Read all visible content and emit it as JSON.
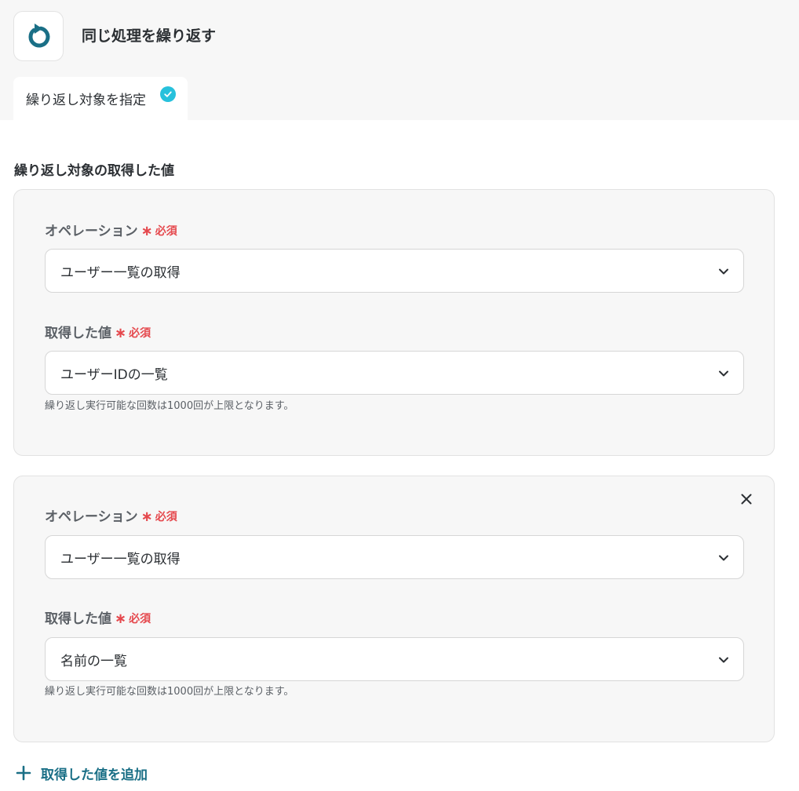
{
  "header": {
    "title": "同じ処理を繰り返す",
    "icon": "loop-icon",
    "icon_color": "#1a6f86"
  },
  "tabs": [
    {
      "label": "繰り返し対象を指定",
      "status": "complete",
      "check_color": "#27c1dc"
    }
  ],
  "section": {
    "title": "繰り返し対象の取得した値"
  },
  "cards": [
    {
      "operation": {
        "label": "オペレーション",
        "required_mark": "∗",
        "required_text": "必須",
        "value": "ユーザー一覧の取得"
      },
      "value_field": {
        "label": "取得した値",
        "required_mark": "∗",
        "required_text": "必須",
        "value": "ユーザーIDの一覧"
      },
      "hint": "繰り返し実行可能な回数は1000回が上限となります。",
      "removable": false
    },
    {
      "operation": {
        "label": "オペレーション",
        "required_mark": "∗",
        "required_text": "必須",
        "value": "ユーザー一覧の取得"
      },
      "value_field": {
        "label": "取得した値",
        "required_mark": "∗",
        "required_text": "必須",
        "value": "名前の一覧"
      },
      "hint": "繰り返し実行可能な回数は1000回が上限となります。",
      "removable": true
    }
  ],
  "add_button": {
    "label": "取得した値を追加",
    "icon": "plus-icon"
  },
  "colors": {
    "accent": "#1a6f86",
    "required": "#e5484d",
    "check": "#27c1dc"
  }
}
